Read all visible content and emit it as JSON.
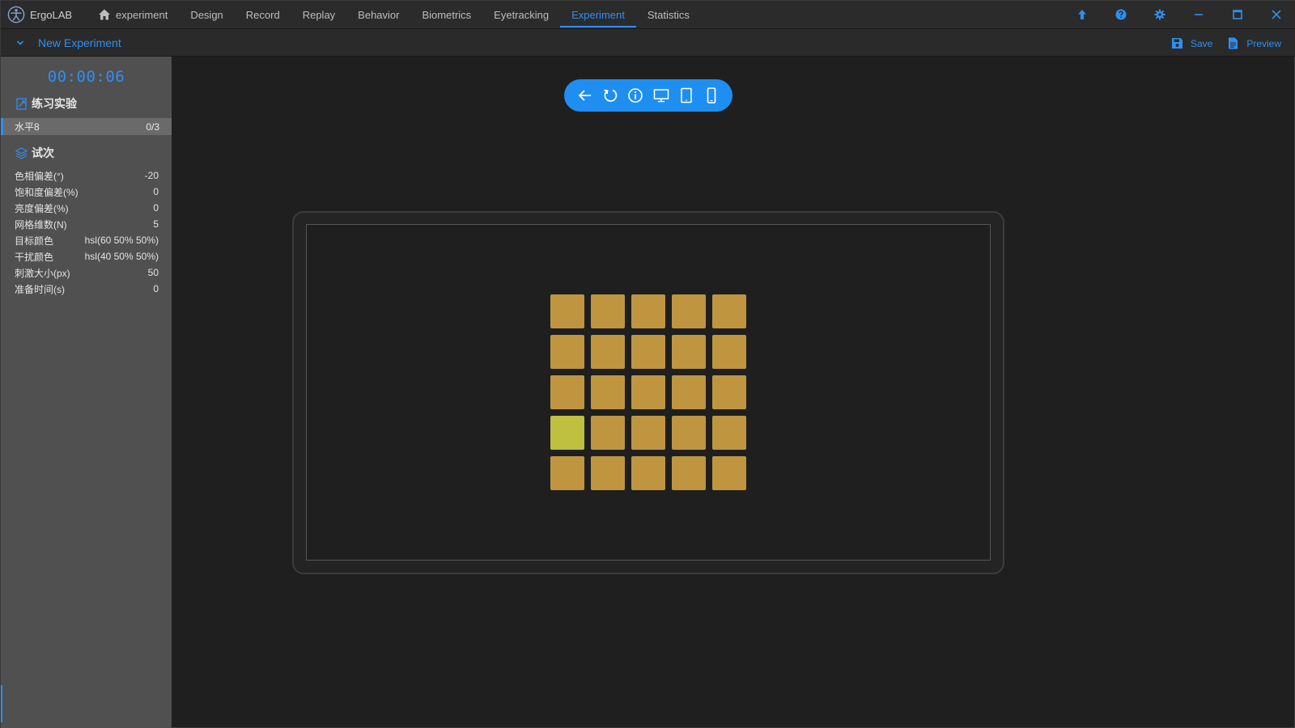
{
  "app": {
    "name": "ErgoLAB",
    "nav": [
      "experiment",
      "Design",
      "Record",
      "Replay",
      "Behavior",
      "Biometrics",
      "Eyetracking",
      "Experiment",
      "Statistics"
    ],
    "active_nav": "Experiment"
  },
  "window_controls": [
    "upload-icon",
    "help-icon",
    "settings-icon",
    "minimize-icon",
    "maximize-icon",
    "close-icon"
  ],
  "subbar": {
    "title": "New Experiment",
    "save_label": "Save",
    "preview_label": "Preview"
  },
  "sidebar": {
    "timer": "00:00:06",
    "practice_title": "练习实验",
    "level": {
      "name": "水平8",
      "progress": "0/3"
    },
    "trial_title": "试次",
    "params": [
      {
        "label": "色相偏差(°)",
        "value": "-20"
      },
      {
        "label": "饱和度偏差(%)",
        "value": "0"
      },
      {
        "label": "亮度偏差(%)",
        "value": "0"
      },
      {
        "label": "网格维数(N)",
        "value": "5"
      },
      {
        "label": "目标颜色",
        "value": "hsl(60 50% 50%)"
      },
      {
        "label": "干扰颜色",
        "value": "hsl(40 50% 50%)"
      },
      {
        "label": "刺激大小(px)",
        "value": "50"
      },
      {
        "label": "准备时间(s)",
        "value": "0"
      }
    ]
  },
  "toolbar": [
    "back-icon",
    "refresh-icon",
    "info-icon",
    "desktop-icon",
    "tablet-icon",
    "phone-icon"
  ],
  "stimulus": {
    "grid_n": 5,
    "target_cell": {
      "row": 4,
      "col": 1
    },
    "target_color": "hsl(60 50% 50%)",
    "distractor_color": "hsl(40 50% 50%)"
  },
  "colors": {
    "accent": "#2f8ff0",
    "target": "#bfbf40",
    "distractor": "#bf9540"
  }
}
